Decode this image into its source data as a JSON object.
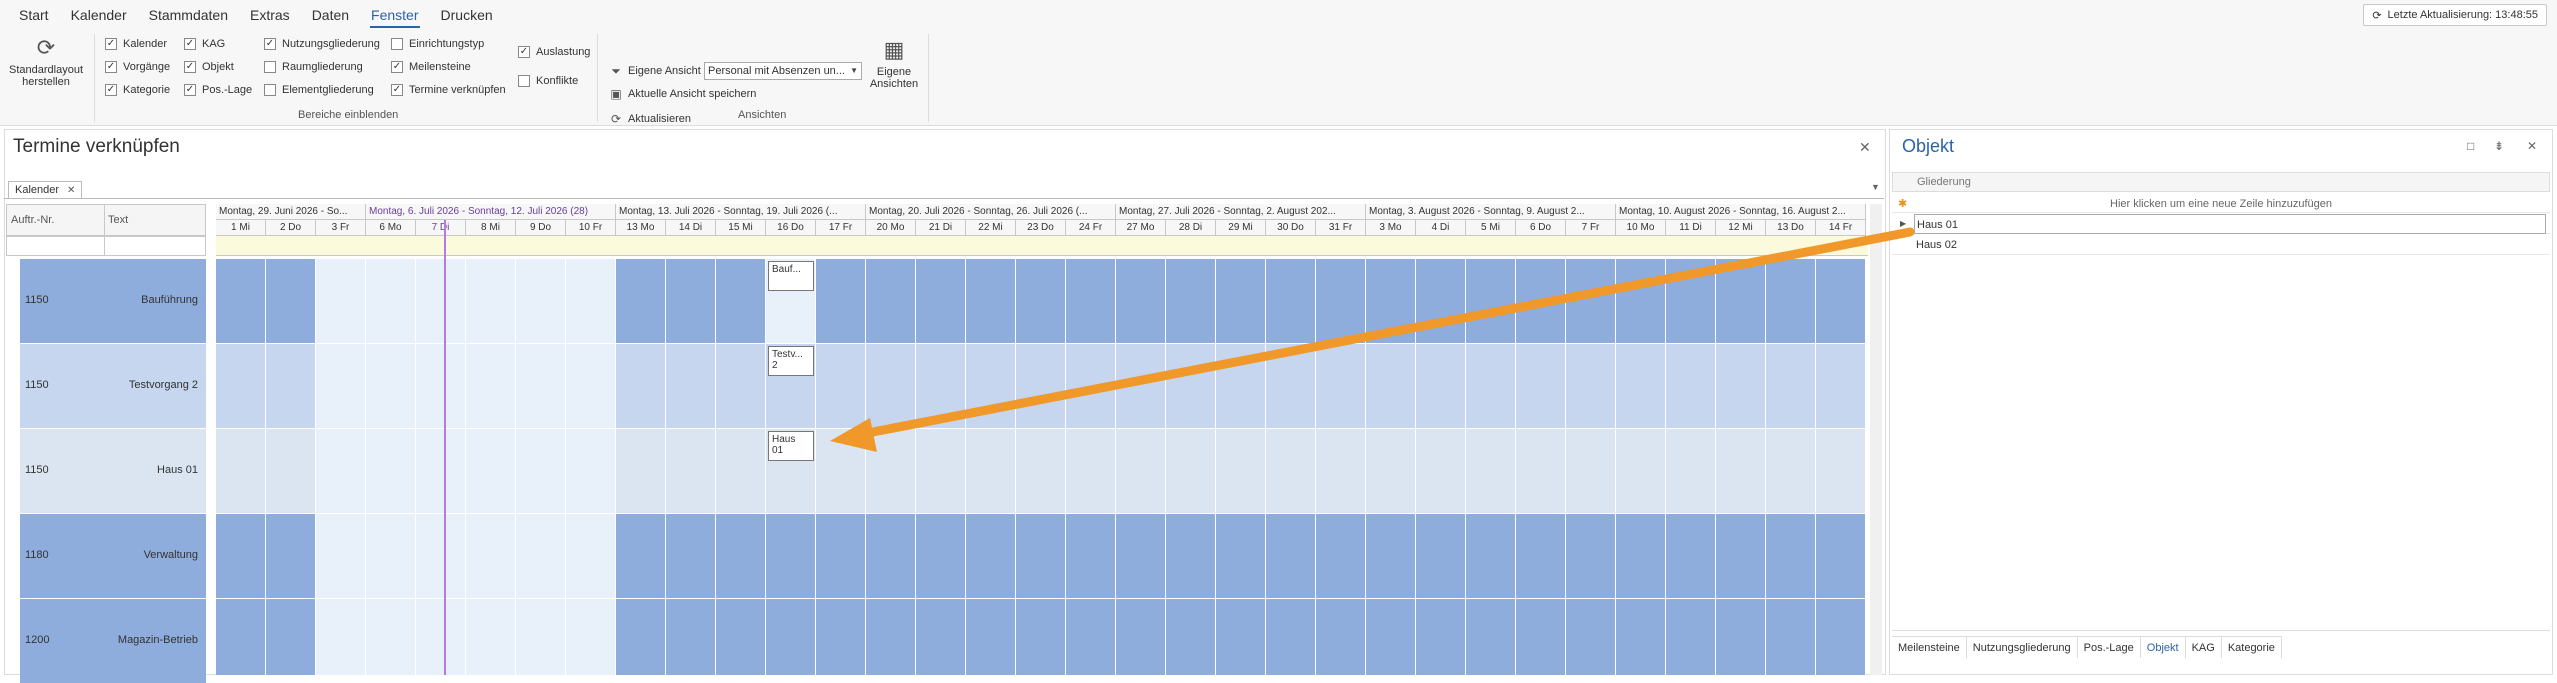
{
  "menu": {
    "tabs": [
      "Start",
      "Kalender",
      "Stammdaten",
      "Extras",
      "Daten",
      "Fenster",
      "Drucken"
    ],
    "active": "Fenster"
  },
  "last_update": {
    "label": "Letzte Aktualisierung: 13:48:55",
    "icon": "refresh-icon"
  },
  "ribbon": {
    "std_layout": {
      "line1": "Standardlayout",
      "line2": "herstellen",
      "icon": "refresh-icon"
    },
    "bereiche": {
      "label": "Bereiche einblenden",
      "checks": [
        {
          "label": "Kalender",
          "checked": true
        },
        {
          "label": "Vorgänge",
          "checked": true
        },
        {
          "label": "Kategorie",
          "checked": true
        },
        {
          "label": "KAG",
          "checked": true
        },
        {
          "label": "Objekt",
          "checked": true
        },
        {
          "label": "Pos.-Lage",
          "checked": true
        },
        {
          "label": "Nutzungsgliederung",
          "checked": true
        },
        {
          "label": "Raumgliederung",
          "checked": false
        },
        {
          "label": "Elementgliederung",
          "checked": false
        },
        {
          "label": "Einrichtungstyp",
          "checked": false
        },
        {
          "label": "Meilensteine",
          "checked": true
        },
        {
          "label": "Termine verknüpfen",
          "checked": true
        },
        {
          "label": "Auslastung",
          "checked": true
        },
        {
          "label": "Konflikte",
          "checked": false
        }
      ]
    },
    "ansichten": {
      "label": "Ansichten",
      "eigene_ansicht_label": "Eigene Ansicht",
      "eigene_ansicht_value": "Personal mit Absenzen un...",
      "save_label": "Aktuelle Ansicht speichern",
      "refresh_label": "Aktualisieren",
      "big_line1": "Eigene",
      "big_line2": "Ansichten"
    }
  },
  "main": {
    "title": "Termine verknüpfen",
    "inner_tab": "Kalender",
    "left_header": {
      "col1": "Auftr.-Nr.",
      "col2": "Text"
    },
    "rows": [
      {
        "nr": "1150",
        "text": "Bauführung"
      },
      {
        "nr": "1150",
        "text": "Testvorgang 2"
      },
      {
        "nr": "1150",
        "text": "Haus 01"
      },
      {
        "nr": "1180",
        "text": "Verwaltung"
      },
      {
        "nr": "1200",
        "text": "Magazin-Betrieb"
      }
    ],
    "weeks": [
      "Montag, 29. Juni 2026 - So...",
      "Montag, 6. Juli 2026 - Sonntag, 12. Juli 2026 (28)",
      "Montag, 13. Juli 2026 - Sonntag, 19. Juli 2026 (...",
      "Montag, 20. Juli 2026 - Sonntag, 26. Juli 2026 (...",
      "Montag, 27. Juli 2026 - Sonntag, 2. August 202...",
      "Montag, 3. August 2026 - Sonntag, 9. August 2...",
      "Montag, 10. August 2026 - Sonntag, 16. August 2..."
    ],
    "days": [
      "1 Mi",
      "2 Do",
      "3 Fr",
      "6 Mo",
      "7 Di",
      "8 Mi",
      "9 Do",
      "10 Fr",
      "13 Mo",
      "14 Di",
      "15 Mi",
      "16 Do",
      "17 Fr",
      "20 Mo",
      "21 Di",
      "22 Mi",
      "23 Do",
      "24 Fr",
      "27 Mo",
      "28 Di",
      "29 Mi",
      "30 Do",
      "31 Fr",
      "3 Mo",
      "4 Di",
      "5 Mi",
      "6 Do",
      "7 Fr",
      "10 Mo",
      "11 Di",
      "12 Mi",
      "13 Do",
      "14 Fr"
    ],
    "tasks": [
      {
        "line1": "Bauf...",
        "line2": ""
      },
      {
        "line1": "Testv...",
        "line2": "2"
      },
      {
        "line1": "Haus",
        "line2": "01"
      }
    ]
  },
  "objekt_panel": {
    "title": "Objekt",
    "column": "Gliederung",
    "new_row_hint": "Hier klicken um eine neue Zeile hinzuzufügen",
    "items": [
      "Haus 01",
      "Haus 02"
    ],
    "tabs": [
      "Meilensteine",
      "Nutzungsgliederung",
      "Pos.-Lage",
      "Objekt",
      "KAG",
      "Kategorie"
    ],
    "active_tab": "Objekt"
  },
  "colors": {
    "accent": "#2a63a8",
    "arrow": "#f0982a",
    "today": "#b37be0"
  }
}
